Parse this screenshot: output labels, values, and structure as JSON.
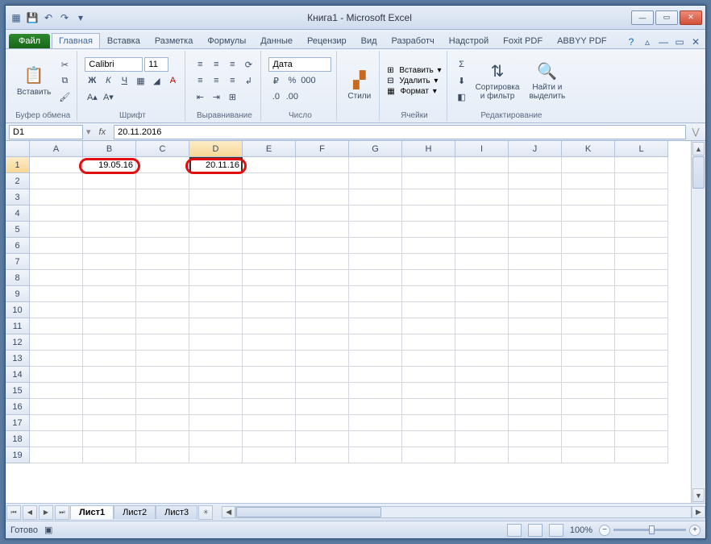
{
  "title": "Книга1  -  Microsoft Excel",
  "tabs": {
    "file": "Файл",
    "items": [
      "Главная",
      "Вставка",
      "Разметка",
      "Формулы",
      "Данные",
      "Рецензир",
      "Вид",
      "Разработч",
      "Надстрой",
      "Foxit PDF",
      "ABBYY PDF"
    ],
    "active": 0
  },
  "ribbon": {
    "clipboard": {
      "paste": "Вставить",
      "label": "Буфер обмена"
    },
    "font": {
      "name": "Calibri",
      "size": "11",
      "label": "Шрифт"
    },
    "align": {
      "label": "Выравнивание"
    },
    "number": {
      "format": "Дата",
      "label": "Число"
    },
    "styles": {
      "label": "Стили",
      "btn": "Стили"
    },
    "cells": {
      "insert": "Вставить",
      "delete": "Удалить",
      "format": "Формат",
      "label": "Ячейки"
    },
    "editing": {
      "sort": "Сортировка\nи фильтр",
      "find": "Найти и\nвыделить",
      "label": "Редактирование"
    }
  },
  "namebox": "D1",
  "formulabar": "20.11.2016",
  "columns": [
    "A",
    "B",
    "C",
    "D",
    "E",
    "F",
    "G",
    "H",
    "I",
    "J",
    "K",
    "L"
  ],
  "rows": 19,
  "activeCell": {
    "r": 1,
    "c": "D"
  },
  "cells": {
    "B1": "19.05.16",
    "D1": "20.11.16"
  },
  "sheets": {
    "items": [
      "Лист1",
      "Лист2",
      "Лист3"
    ],
    "active": 0
  },
  "status": {
    "ready": "Готово",
    "zoom": "100%"
  }
}
